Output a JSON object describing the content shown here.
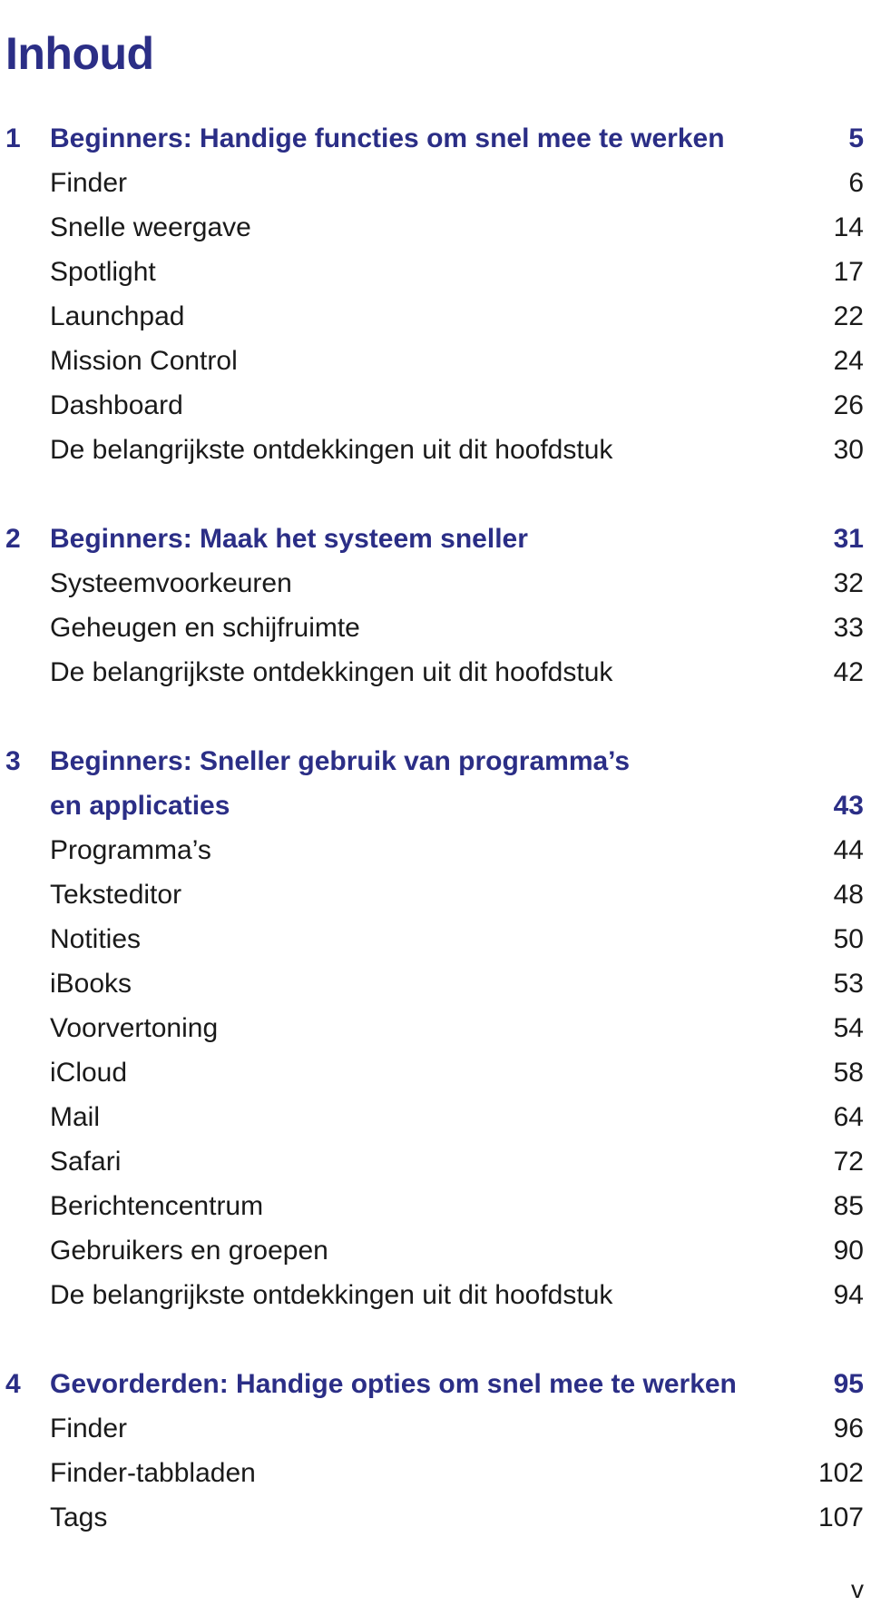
{
  "title": "Inhoud",
  "chapters": [
    {
      "number": "1",
      "title": "Beginners: Handige functies om snel mee te werken",
      "page": "5",
      "sections": [
        {
          "label": "Finder",
          "page": "6"
        },
        {
          "label": "Snelle weergave",
          "page": "14"
        },
        {
          "label": "Spotlight",
          "page": "17"
        },
        {
          "label": "Launchpad",
          "page": "22"
        },
        {
          "label": "Mission Control",
          "page": "24"
        },
        {
          "label": "Dashboard",
          "page": "26"
        },
        {
          "label": "De belangrijkste ontdekkingen uit dit hoofdstuk",
          "page": "30"
        }
      ]
    },
    {
      "number": "2",
      "title": "Beginners: Maak het systeem sneller",
      "page": "31",
      "sections": [
        {
          "label": "Systeemvoorkeuren",
          "page": "32"
        },
        {
          "label": "Geheugen en schijfruimte",
          "page": "33"
        },
        {
          "label": "De belangrijkste ontdekkingen uit dit hoofdstuk",
          "page": "42"
        }
      ]
    },
    {
      "number": "3",
      "title_line1": "Beginners: Sneller gebruik van programma’s",
      "title_line2": "en applicaties",
      "page": "43",
      "sections": [
        {
          "label": "Programma’s",
          "page": "44"
        },
        {
          "label": "Teksteditor",
          "page": "48"
        },
        {
          "label": "Notities",
          "page": "50"
        },
        {
          "label": "iBooks",
          "page": "53"
        },
        {
          "label": "Voorvertoning",
          "page": "54"
        },
        {
          "label": "iCloud",
          "page": "58"
        },
        {
          "label": "Mail",
          "page": "64"
        },
        {
          "label": "Safari",
          "page": "72"
        },
        {
          "label": "Berichtencentrum",
          "page": "85"
        },
        {
          "label": "Gebruikers en groepen",
          "page": "90"
        },
        {
          "label": "De belangrijkste ontdekkingen uit dit hoofdstuk",
          "page": "94"
        }
      ]
    },
    {
      "number": "4",
      "title": "Gevorderden: Handige opties om snel mee te werken",
      "page": "95",
      "sections": [
        {
          "label": "Finder",
          "page": "96"
        },
        {
          "label": "Finder-tabbladen",
          "page": "102"
        },
        {
          "label": "Tags",
          "page": "107"
        }
      ]
    }
  ],
  "page_marker": "v",
  "colors": {
    "heading": "#2b2e86",
    "text": "#1a1a1a"
  }
}
